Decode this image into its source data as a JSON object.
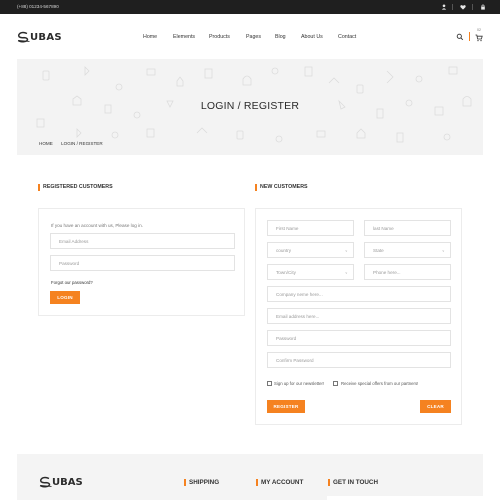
{
  "topbar": {
    "phone": "(+88) 01234-567890",
    "icons": [
      "user-icon",
      "heart-icon",
      "lock-icon"
    ]
  },
  "header": {
    "logo": "UBAS",
    "nav": [
      "Home",
      "Elements",
      "Products",
      "Pages",
      "Blog",
      "About Us",
      "Contact"
    ],
    "cart_count": "02"
  },
  "banner": {
    "title": "LOGIN / REGISTER",
    "breadcrumb": [
      "HOME",
      "LOGIN / REGISTER"
    ]
  },
  "login": {
    "heading": "REGISTERED CUSTOMERS",
    "intro": "If you have an account with us, Please log in.",
    "email_placeholder": "Email Address",
    "password_placeholder": "Password",
    "forgot": "Forgot our password?",
    "button": "LOGIN"
  },
  "register": {
    "heading": "NEW CUSTOMERS",
    "first_name": "First Name",
    "last_name": "last Name",
    "country": "country",
    "state": "State",
    "town": "Town/City",
    "phone": "Phone here...",
    "company": "Company neme here...",
    "email": "Email address here...",
    "password": "Password",
    "confirm_password": "Confirm Password",
    "newsletter": "Sign up for our newsletter!",
    "offers": "Receive special offers from our partners!",
    "register_button": "REGISTER",
    "clear_button": "CLEAR"
  },
  "footer": {
    "logo": "UBAS",
    "headings": [
      "SHIPPING",
      "MY ACCOUNT",
      "GET IN TOUCH"
    ]
  },
  "colors": {
    "accent": "#f58220",
    "topbar_bg": "#1f1f1f",
    "banner_bg": "#f3f3f3",
    "footer_bg": "#f4f4f4"
  }
}
